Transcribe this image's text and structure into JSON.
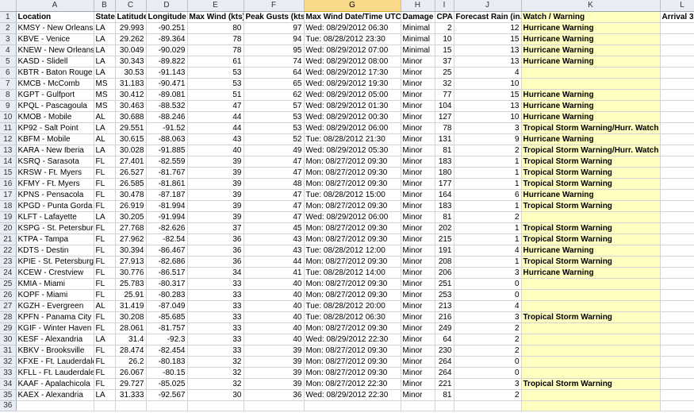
{
  "column_letters": [
    "A",
    "B",
    "C",
    "D",
    "E",
    "F",
    "G",
    "H",
    "I",
    "J",
    "K",
    "L"
  ],
  "active_column": "G",
  "headers": [
    "Location",
    "State",
    "Latitude",
    "Longitude",
    "Max Wind (kts)",
    "Peak Gusts (kts)",
    "Max Wind Date/Time UTC",
    "Damage",
    "CPA",
    "Forecast Rain (in.)",
    "Watch / Warning",
    "Arrival 3"
  ],
  "rows": [
    [
      "KMSY - New Orleans",
      "LA",
      "29.993",
      "-90.251",
      "80",
      "97",
      "Wed: 08/29/2012 06:30",
      "Minimal",
      "2",
      "12",
      "Hurricane Warning"
    ],
    [
      "KBVE - Venice",
      "LA",
      "29.262",
      "-89.364",
      "78",
      "94",
      "Tue: 08/28/2012 23:30",
      "Minimal",
      "10",
      "15",
      "Hurricane Warning"
    ],
    [
      "KNEW - New Orleans",
      "LA",
      "30.049",
      "-90.029",
      "78",
      "95",
      "Wed: 08/29/2012 07:00",
      "Minimal",
      "15",
      "13",
      "Hurricane Warning"
    ],
    [
      "KASD - Slidell",
      "LA",
      "30.343",
      "-89.822",
      "61",
      "74",
      "Wed: 08/29/2012 08:00",
      "Minor",
      "37",
      "13",
      "Hurricane Warning"
    ],
    [
      "KBTR - Baton Rouge",
      "LA",
      "30.53",
      "-91.143",
      "53",
      "64",
      "Wed: 08/29/2012 17:30",
      "Minor",
      "25",
      "4",
      ""
    ],
    [
      "KMCB - McComb",
      "MS",
      "31.183",
      "-90.471",
      "53",
      "65",
      "Wed: 08/29/2012 19:30",
      "Minor",
      "32",
      "10",
      ""
    ],
    [
      "KGPT - Gulfport",
      "MS",
      "30.412",
      "-89.081",
      "51",
      "62",
      "Wed: 08/29/2012 05:00",
      "Minor",
      "77",
      "15",
      "Hurricane Warning"
    ],
    [
      "KPQL - Pascagoula",
      "MS",
      "30.463",
      "-88.532",
      "47",
      "57",
      "Wed: 08/29/2012 01:30",
      "Minor",
      "104",
      "13",
      "Hurricane Warning"
    ],
    [
      "KMOB - Mobile",
      "AL",
      "30.688",
      "-88.246",
      "44",
      "53",
      "Wed: 08/29/2012 00:30",
      "Minor",
      "127",
      "10",
      "Hurricane Warning"
    ],
    [
      "KP92 - Salt Point",
      "LA",
      "29.551",
      "-91.52",
      "44",
      "53",
      "Wed: 08/29/2012 06:00",
      "Minor",
      "78",
      "3",
      "Tropical Storm Warning/Hurr. Watch"
    ],
    [
      "KBFM - Mobile",
      "AL",
      "30.615",
      "-88.063",
      "43",
      "52",
      "Tue: 08/28/2012 21:30",
      "Minor",
      "131",
      "9",
      "Hurricane Warning"
    ],
    [
      "KARA - New Iberia",
      "LA",
      "30.028",
      "-91.885",
      "40",
      "49",
      "Wed: 08/29/2012 05:30",
      "Minor",
      "81",
      "2",
      "Tropical Storm Warning/Hurr. Watch"
    ],
    [
      "KSRQ - Sarasota",
      "FL",
      "27.401",
      "-82.559",
      "39",
      "47",
      "Mon: 08/27/2012 09:30",
      "Minor",
      "183",
      "1",
      "Tropical Storm Warning"
    ],
    [
      "KRSW - Ft. Myers",
      "FL",
      "26.527",
      "-81.767",
      "39",
      "47",
      "Mon: 08/27/2012 09:30",
      "Minor",
      "180",
      "1",
      "Tropical Storm Warning"
    ],
    [
      "KFMY - Ft. Myers",
      "FL",
      "26.585",
      "-81.861",
      "39",
      "48",
      "Mon: 08/27/2012 09:30",
      "Minor",
      "177",
      "1",
      "Tropical Storm Warning"
    ],
    [
      "KPNS - Pensacola",
      "FL",
      "30.478",
      "-87.187",
      "39",
      "47",
      "Tue: 08/28/2012 15:00",
      "Minor",
      "164",
      "6",
      "Hurricane Warning"
    ],
    [
      "KPGD - Punta Gorda",
      "FL",
      "26.919",
      "-81.994",
      "39",
      "47",
      "Mon: 08/27/2012 09:30",
      "Minor",
      "183",
      "1",
      "Tropical Storm Warning"
    ],
    [
      "KLFT - Lafayette",
      "LA",
      "30.205",
      "-91.994",
      "39",
      "47",
      "Wed: 08/29/2012 06:00",
      "Minor",
      "81",
      "2",
      ""
    ],
    [
      "KSPG - St. Petersburg",
      "FL",
      "27.768",
      "-82.626",
      "37",
      "45",
      "Mon: 08/27/2012 09:30",
      "Minor",
      "202",
      "1",
      "Tropical Storm Warning"
    ],
    [
      "KTPA - Tampa",
      "FL",
      "27.962",
      "-82.54",
      "36",
      "43",
      "Mon: 08/27/2012 09:30",
      "Minor",
      "215",
      "1",
      "Tropical Storm Warning"
    ],
    [
      "KDTS - Destin",
      "FL",
      "30.394",
      "-86.467",
      "36",
      "43",
      "Tue: 08/28/2012 12:00",
      "Minor",
      "191",
      "4",
      "Hurricane Warning"
    ],
    [
      "KPIE - St. Petersburg",
      "FL",
      "27.913",
      "-82.686",
      "36",
      "44",
      "Mon: 08/27/2012 09:30",
      "Minor",
      "208",
      "1",
      "Tropical Storm Warning"
    ],
    [
      "KCEW - Crestview",
      "FL",
      "30.776",
      "-86.517",
      "34",
      "41",
      "Tue: 08/28/2012 14:00",
      "Minor",
      "206",
      "3",
      "Hurricane Warning"
    ],
    [
      "KMIA - Miami",
      "FL",
      "25.783",
      "-80.317",
      "33",
      "40",
      "Mon: 08/27/2012 09:30",
      "Minor",
      "251",
      "0",
      ""
    ],
    [
      "KOPF - Miami",
      "FL",
      "25.91",
      "-80.283",
      "33",
      "40",
      "Mon: 08/27/2012 09:30",
      "Minor",
      "253",
      "0",
      ""
    ],
    [
      "KGZH - Evergreen",
      "AL",
      "31.419",
      "-87.049",
      "33",
      "40",
      "Tue: 08/28/2012 20:00",
      "Minor",
      "213",
      "4",
      ""
    ],
    [
      "KPFN - Panama City",
      "FL",
      "30.208",
      "-85.685",
      "33",
      "40",
      "Tue: 08/28/2012 06:30",
      "Minor",
      "216",
      "3",
      "Tropical Storm Warning"
    ],
    [
      "KGIF - Winter Haven",
      "FL",
      "28.061",
      "-81.757",
      "33",
      "40",
      "Mon: 08/27/2012 09:30",
      "Minor",
      "249",
      "2",
      ""
    ],
    [
      "KESF - Alexandria",
      "LA",
      "31.4",
      "-92.3",
      "33",
      "40",
      "Wed: 08/29/2012 22:30",
      "Minor",
      "64",
      "2",
      ""
    ],
    [
      "KBKV - Brooksville",
      "FL",
      "28.474",
      "-82.454",
      "33",
      "39",
      "Mon: 08/27/2012 09:30",
      "Minor",
      "230",
      "2",
      ""
    ],
    [
      "KFXE - Ft. Lauderdale",
      "FL",
      "26.2",
      "-80.183",
      "32",
      "39",
      "Mon: 08/27/2012 09:30",
      "Minor",
      "264",
      "0",
      ""
    ],
    [
      "KFLL - Ft. Lauderdale",
      "FL",
      "26.067",
      "-80.15",
      "32",
      "39",
      "Mon: 08/27/2012 09:30",
      "Minor",
      "264",
      "0",
      ""
    ],
    [
      "KAAF - Apalachicola",
      "FL",
      "29.727",
      "-85.025",
      "32",
      "39",
      "Mon: 08/27/2012 22:30",
      "Minor",
      "221",
      "3",
      "Tropical Storm Warning"
    ],
    [
      "KAEX - Alexandria",
      "LA",
      "31.333",
      "-92.567",
      "30",
      "36",
      "Wed: 08/29/2012 22:30",
      "Minor",
      "81",
      "2",
      ""
    ],
    [
      "",
      "",
      "",
      "",
      "",
      "",
      "",
      "",
      "",
      "",
      ""
    ]
  ]
}
